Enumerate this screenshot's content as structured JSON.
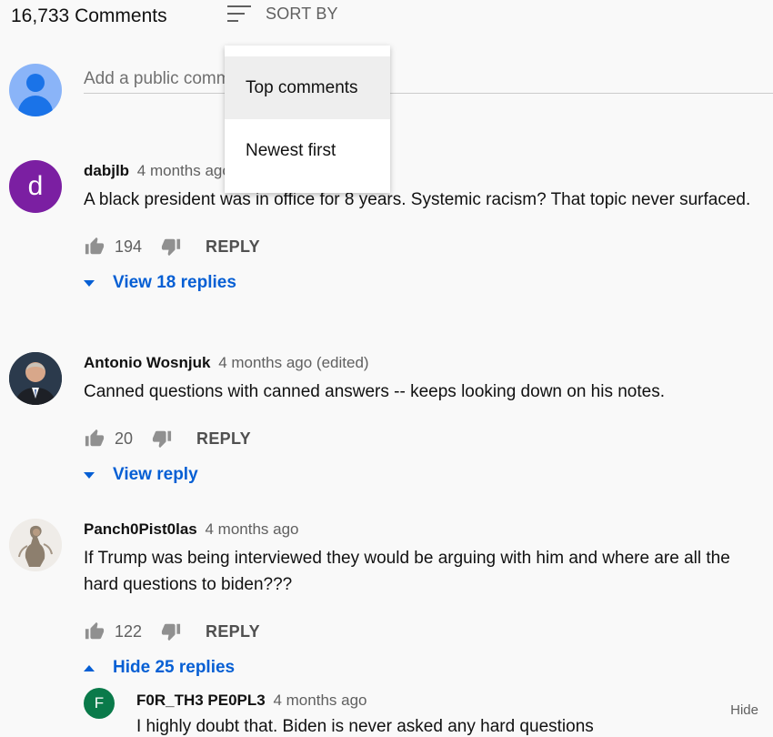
{
  "header": {
    "count": "16,733 Comments",
    "sort_label": "SORT BY"
  },
  "add_comment": {
    "placeholder": "Add a public comment..."
  },
  "sort_menu": {
    "items": [
      "Top comments",
      "Newest first"
    ],
    "selected": "Top comments"
  },
  "comments": [
    {
      "avatar_letter": "d",
      "author": "dabjlb",
      "time": "4 months ago",
      "text": "A black president was in office for 8 years. Systemic racism? That topic never surfaced.",
      "likes": "194",
      "reply_label": "REPLY",
      "replies_label": "View 18 replies"
    },
    {
      "author": "Antonio Wosnjuk",
      "time": "4 months ago (edited)",
      "text": "Canned questions with canned answers -- keeps looking down on his notes.",
      "likes": "20",
      "reply_label": "REPLY",
      "replies_label": "View reply"
    },
    {
      "author": "Panch0Pist0las",
      "time": "4 months ago",
      "text": "If Trump was being interviewed they would be arguing with him and where are all the hard questions to biden???",
      "likes": "122",
      "reply_label": "REPLY",
      "replies_label": "Hide 25 replies"
    }
  ],
  "reply": {
    "avatar_letter": "F",
    "author": "F0R_TH3 PE0PL3",
    "time": "4 months ago",
    "text": "I highly doubt that. Biden is never asked any hard questions"
  },
  "hide_label": "Hide",
  "icons": [
    "sort-icon",
    "thumb-up-icon",
    "thumb-down-icon",
    "chevron-down-icon",
    "chevron-up-icon",
    "default-avatar-icon"
  ],
  "colors": {
    "link": "#065fd4",
    "avatar_purple": "#7b1fa2",
    "avatar_green": "#0a7a4a",
    "default_avatar": "#8ab4f8"
  }
}
